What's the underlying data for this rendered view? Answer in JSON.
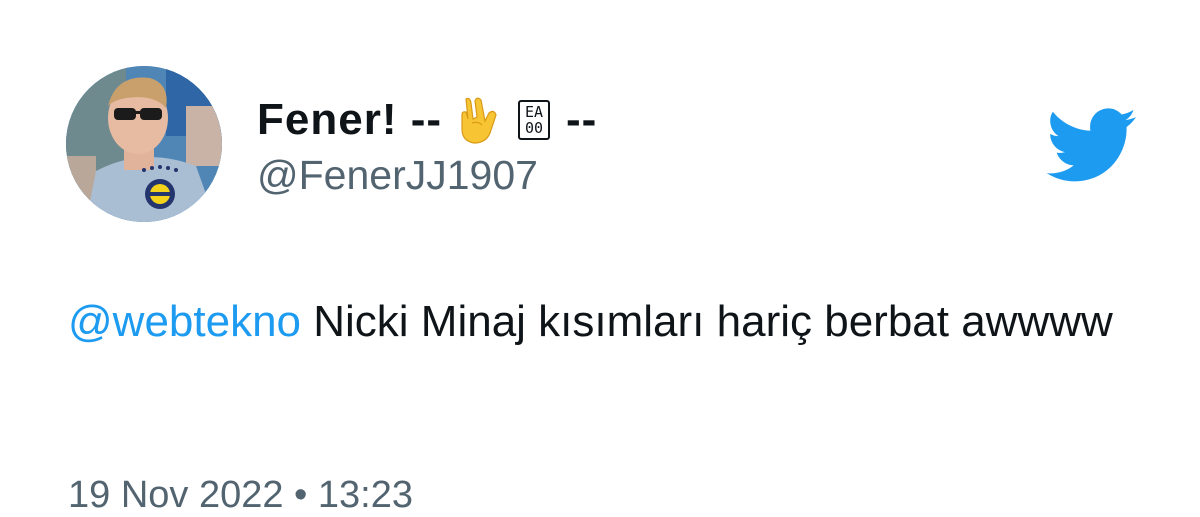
{
  "tweet": {
    "author": {
      "name_prefix": "Fener! --",
      "name_emoji": "horns-hand-emoji",
      "name_box_top": "EA",
      "name_box_bottom": "00",
      "name_suffix": "--",
      "handle": "@FenerJJ1907"
    },
    "text": {
      "mention": "@webtekno",
      "body": " Nicki Minaj kısımları hariç berbat awwww"
    },
    "timestamp": "19 Nov 2022 • 13:23"
  },
  "icons": {
    "brand": "twitter-bird-icon"
  },
  "colors": {
    "link": "#1d9bf0",
    "brand": "#1d9bf0",
    "secondary_text": "#536471",
    "primary_text": "#0f1419"
  }
}
